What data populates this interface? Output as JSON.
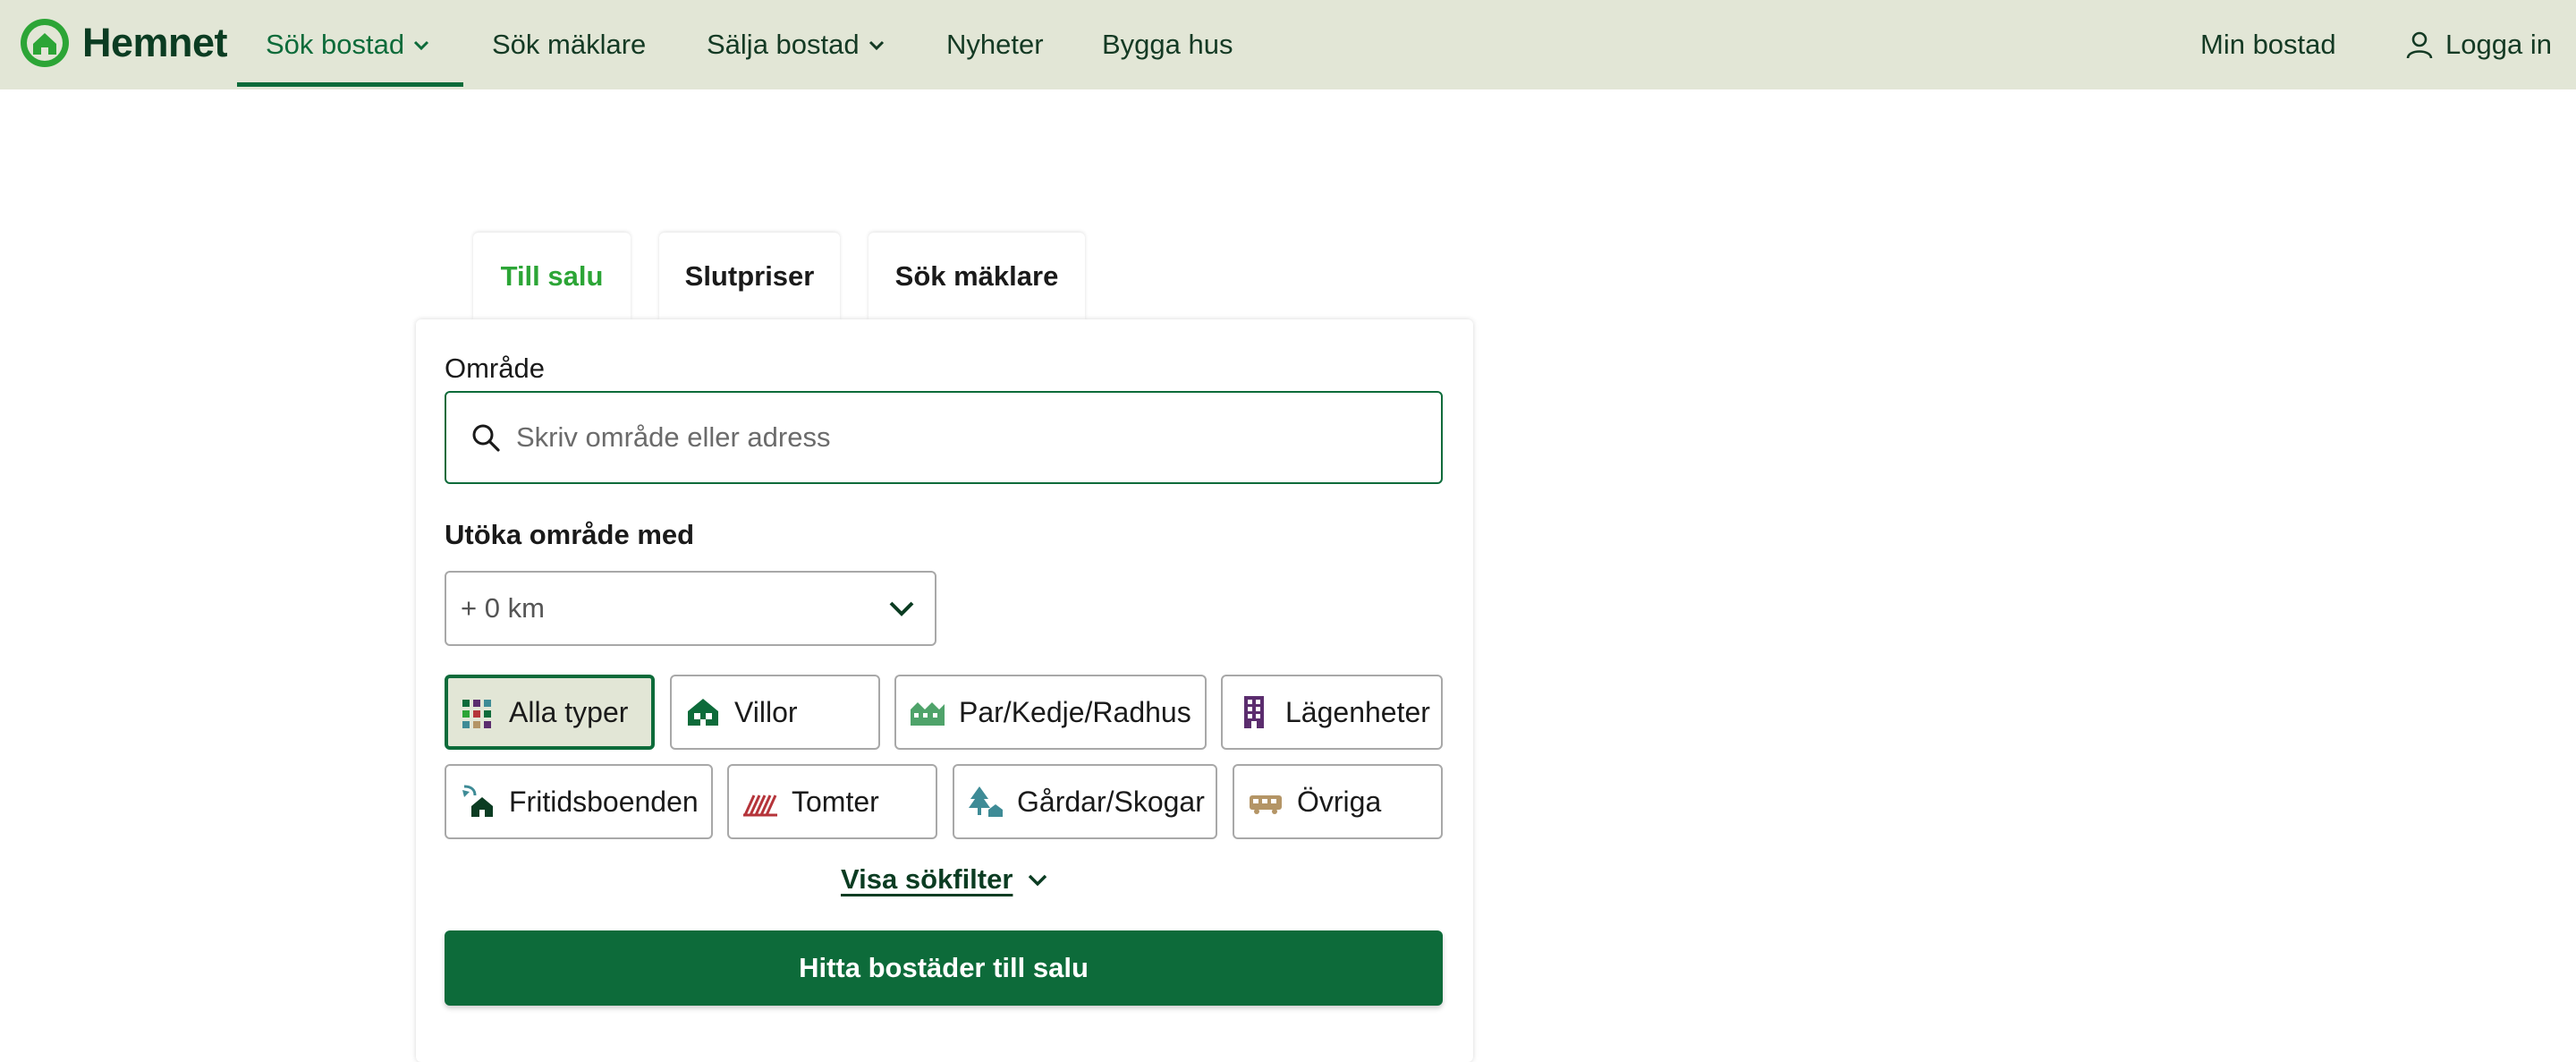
{
  "header": {
    "logo_text": "Hemnet",
    "nav": [
      {
        "label": "Sök bostad",
        "has_dropdown": true,
        "active": true
      },
      {
        "label": "Sök mäklare",
        "has_dropdown": false
      },
      {
        "label": "Sälja bostad",
        "has_dropdown": true
      },
      {
        "label": "Nyheter",
        "has_dropdown": false
      },
      {
        "label": "Bygga hus",
        "has_dropdown": false
      }
    ],
    "my_home": "Min bostad",
    "login": "Logga in"
  },
  "tabs": [
    {
      "label": "Till salu",
      "active": true
    },
    {
      "label": "Slutpriser",
      "active": false
    },
    {
      "label": "Sök mäklare",
      "active": false
    }
  ],
  "search": {
    "area_label": "Område",
    "placeholder": "Skriv område eller adress",
    "value": "",
    "expand_label": "Utöka område med",
    "expand_value": "+ 0 km"
  },
  "property_types": [
    {
      "label": "Alla typer",
      "icon": "grid-icon",
      "selected": true
    },
    {
      "label": "Villor",
      "icon": "villa-icon",
      "selected": false
    },
    {
      "label": "Par/Kedje/Radhus",
      "icon": "townhouse-icon",
      "selected": false
    },
    {
      "label": "Lägenheter",
      "icon": "apartment-icon",
      "selected": false
    },
    {
      "label": "Fritidsboenden",
      "icon": "holiday-home-icon",
      "selected": false
    },
    {
      "label": "Tomter",
      "icon": "plot-icon",
      "selected": false
    },
    {
      "label": "Gårdar/Skogar",
      "icon": "farm-forest-icon",
      "selected": false
    },
    {
      "label": "Övriga",
      "icon": "other-icon",
      "selected": false
    }
  ],
  "filters_link": "Visa sökfilter",
  "submit_label": "Hitta bostäder till salu",
  "colors": {
    "brand_green": "#0d6b3a",
    "header_bg": "#e2e6d6",
    "active_tab_green": "#2ca536",
    "apartment_purple": "#5b2d6e",
    "plot_red": "#b5343a",
    "farm_teal": "#3e8b96",
    "other_tan": "#b49566"
  }
}
